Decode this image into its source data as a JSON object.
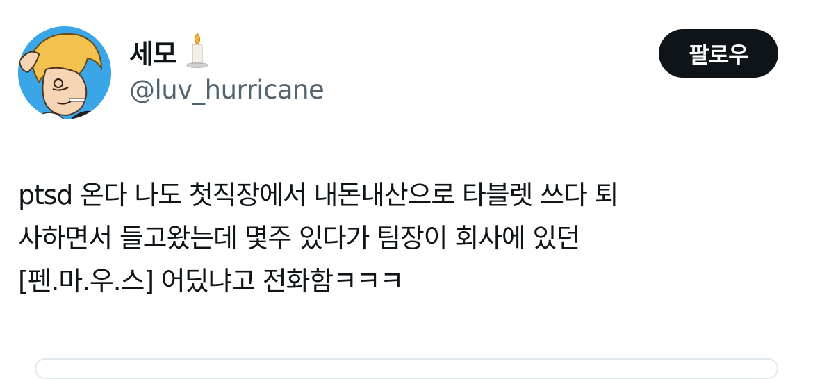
{
  "tweet": {
    "display_name": "세모",
    "name_emoji": "candle-icon",
    "handle": "@luv_hurricane",
    "follow_label": "팔로우",
    "text_lines": [
      "ptsd 온다 나도 첫직장에서 내돈내산으로 타블렛 쓰다 퇴",
      "사하면서 들고왔는데 몇주 있다가 팀장이 회사에 있던",
      "[펜.마.우.스] 어딨냐고 전화함ㅋㅋㅋ"
    ]
  },
  "colors": {
    "text_primary": "#0f1419",
    "text_secondary": "#536471",
    "follow_bg": "#0f1419",
    "follow_text": "#ffffff",
    "avatar_bg": "#3aa6e8"
  }
}
